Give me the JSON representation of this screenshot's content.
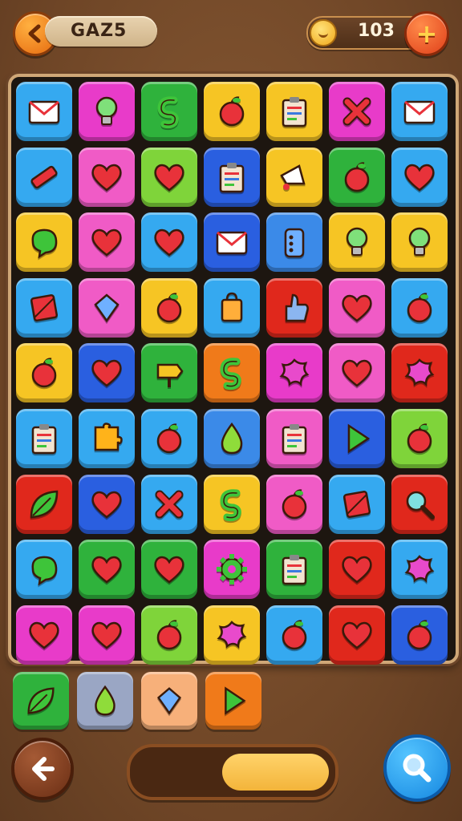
{
  "header": {
    "level_label": "GAZ5",
    "coins": "103"
  },
  "icons": {
    "back_top": "back-arrow-icon",
    "coin": "coin-icon",
    "add": "plus-icon",
    "back_bottom": "back-arrow-icon",
    "search": "magnifier-icon"
  },
  "progress": {
    "fraction": 0.52
  },
  "board": {
    "rows": [
      [
        {
          "color": "#35a9f0",
          "icon": "envelope"
        },
        {
          "color": "#e83bc9",
          "icon": "bulb"
        },
        {
          "color": "#2fb23c",
          "icon": "swirl"
        },
        {
          "color": "#f6c524",
          "icon": "apple"
        },
        {
          "color": "#f6c524",
          "icon": "clipboard"
        },
        {
          "color": "#e83bc9",
          "icon": "cross"
        },
        {
          "color": "#35a9f0",
          "icon": "envelope"
        }
      ],
      [
        {
          "color": "#35a9f0",
          "icon": "marker"
        },
        {
          "color": "#f05bc6",
          "icon": "heart"
        },
        {
          "color": "#7fd43a",
          "icon": "heart"
        },
        {
          "color": "#2a5fe0",
          "icon": "clipboard"
        },
        {
          "color": "#f6c524",
          "icon": "megaphone"
        },
        {
          "color": "#2fb23c",
          "icon": "apple"
        },
        {
          "color": "#35a9f0",
          "icon": "heart"
        }
      ],
      [
        {
          "color": "#f6c524",
          "icon": "blob"
        },
        {
          "color": "#f05bc6",
          "icon": "heart"
        },
        {
          "color": "#35a9f0",
          "icon": "heart"
        },
        {
          "color": "#2a5fe0",
          "icon": "envelope"
        },
        {
          "color": "#3b8ae8",
          "icon": "phone"
        },
        {
          "color": "#f6c524",
          "icon": "bulb"
        },
        {
          "color": "#f6c524",
          "icon": "bulb"
        }
      ],
      [
        {
          "color": "#35a9f0",
          "icon": "box"
        },
        {
          "color": "#f05bc6",
          "icon": "gem"
        },
        {
          "color": "#f6c524",
          "icon": "apple"
        },
        {
          "color": "#35a9f0",
          "icon": "bag"
        },
        {
          "color": "#e0281c",
          "icon": "thumb"
        },
        {
          "color": "#f05bc6",
          "icon": "heart"
        },
        {
          "color": "#35a9f0",
          "icon": "apple"
        }
      ],
      [
        {
          "color": "#f6c524",
          "icon": "apple"
        },
        {
          "color": "#2a5fe0",
          "icon": "heart"
        },
        {
          "color": "#2fb23c",
          "icon": "sign"
        },
        {
          "color": "#f07a1a",
          "icon": "swirl"
        },
        {
          "color": "#e83bc9",
          "icon": "splat"
        },
        {
          "color": "#f05bc6",
          "icon": "heart"
        },
        {
          "color": "#e0281c",
          "icon": "splat"
        }
      ],
      [
        {
          "color": "#35a9f0",
          "icon": "clipboard"
        },
        {
          "color": "#35a9f0",
          "icon": "puzzle"
        },
        {
          "color": "#35a9f0",
          "icon": "apple"
        },
        {
          "color": "#3b8ae8",
          "icon": "drop"
        },
        {
          "color": "#f05bc6",
          "icon": "clipboard"
        },
        {
          "color": "#2a5fe0",
          "icon": "play"
        },
        {
          "color": "#7fd43a",
          "icon": "apple"
        }
      ],
      [
        {
          "color": "#e0281c",
          "icon": "leaf"
        },
        {
          "color": "#2a5fe0",
          "icon": "heart"
        },
        {
          "color": "#35a9f0",
          "icon": "cross"
        },
        {
          "color": "#f6c524",
          "icon": "swirl"
        },
        {
          "color": "#f05bc6",
          "icon": "apple"
        },
        {
          "color": "#35a9f0",
          "icon": "box"
        },
        {
          "color": "#e0281c",
          "icon": "magnifier"
        }
      ],
      [
        {
          "color": "#35a9f0",
          "icon": "blob"
        },
        {
          "color": "#2fb23c",
          "icon": "heart"
        },
        {
          "color": "#2fb23c",
          "icon": "heart"
        },
        {
          "color": "#e83bc9",
          "icon": "gear"
        },
        {
          "color": "#2fb23c",
          "icon": "clipboard"
        },
        {
          "color": "#e0281c",
          "icon": "heart"
        },
        {
          "color": "#35a9f0",
          "icon": "splat"
        }
      ],
      [
        {
          "color": "#e83bc9",
          "icon": "heart"
        },
        {
          "color": "#e83bc9",
          "icon": "heart"
        },
        {
          "color": "#7fd43a",
          "icon": "apple"
        },
        {
          "color": "#f6c524",
          "icon": "splat"
        },
        {
          "color": "#35a9f0",
          "icon": "apple"
        },
        {
          "color": "#e0281c",
          "icon": "heart"
        },
        {
          "color": "#2a5fe0",
          "icon": "apple"
        }
      ]
    ]
  },
  "tray": [
    {
      "color": "#2fb23c",
      "icon": "leaf"
    },
    {
      "color": "#9aa6c4",
      "icon": "drop"
    },
    {
      "color": "#f7b07a",
      "icon": "gem"
    },
    {
      "color": "#f07a1a",
      "icon": "play"
    }
  ]
}
